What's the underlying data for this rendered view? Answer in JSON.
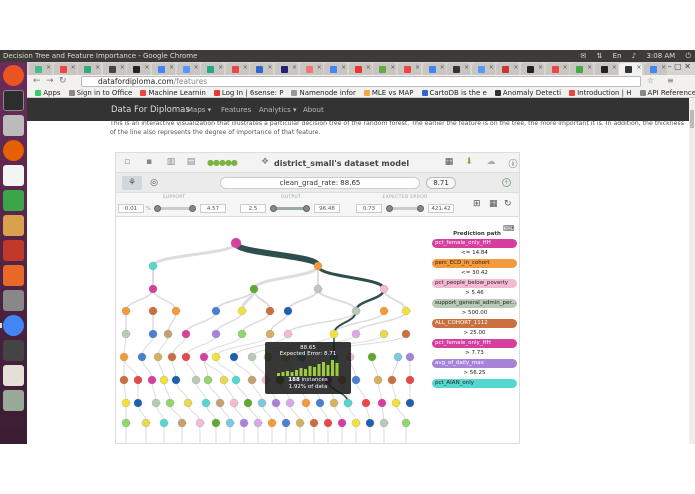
{
  "window": {
    "title": "Decision Tree and Feature Importance - Google Chrome",
    "time": "3:08 AM"
  },
  "browser": {
    "url_host": "datafordiploma.com",
    "url_path": "/features",
    "bookmarks": [
      "Apps",
      "Sign in to Office",
      "Machine Learnin",
      "Log In | 6sense: P",
      "Namenode infor",
      "MLE vs MAP",
      "CartoDB is the e",
      "Anomaly Detecti",
      "Introduction | H",
      "API Reference D"
    ]
  },
  "site": {
    "brand": "Data For Diplomas",
    "nav": [
      "Maps ▾",
      "Features",
      "Analytics ▾",
      "About"
    ],
    "intro": "This is an interactive visualization that illustrates a particular decision tree of the random forest. The earlier the feature is on the tree, the more important it is. In addition, the thickness of the line also represents the degree of importance of that feature."
  },
  "model": {
    "title": "district_small's dataset model",
    "prediction_text": "clean_grad_rate: 88.65",
    "prediction_value": "8.71",
    "filters": [
      {
        "label": "SUPPORT",
        "min": "0.01",
        "max": "4.57",
        "pct": "%"
      },
      {
        "label": "OUTPUT",
        "min": "2.5",
        "max": "96.48",
        "pct": ""
      },
      {
        "label": "EXPECTED ERROR",
        "min": "0.73",
        "max": "421.42",
        "pct": ""
      }
    ],
    "legend_title": "Prediction path",
    "path": [
      {
        "label": "pct_female_only_HH",
        "color": "#d63fa0",
        "thr": "<= 14.84"
      },
      {
        "label": "perc_ECD_in_cohort",
        "color": "#f39a3c",
        "thr": "<= 30.42"
      },
      {
        "label": "pct_people_below_poverty",
        "color": "#f5b9d6",
        "thr": "> 5.46"
      },
      {
        "label": "support_general_admin_per...",
        "color": "#b8c9b6",
        "thr": "> 500.00"
      },
      {
        "label": "ALL_COHORT_1112",
        "color": "#c9703e",
        "thr": "> 25.00"
      },
      {
        "label": "pct_female_only_HH",
        "color": "#d63fa0",
        "thr": "> 7.73"
      },
      {
        "label": "avg_of_daily_max",
        "color": "#a884d8",
        "thr": "> 56.25"
      },
      {
        "label": "pct_AIAN_only",
        "color": "#55d6d0",
        "thr": ""
      }
    ],
    "tooltip": {
      "value": "88.65",
      "error": "Expected Error: 8.71",
      "instances": "188",
      "instances_label": " instances",
      "pct": "1.92% of data"
    }
  },
  "colors": {
    "accent": "#d63fa0",
    "navbar": "#333333",
    "launcher": "#5e2750"
  }
}
